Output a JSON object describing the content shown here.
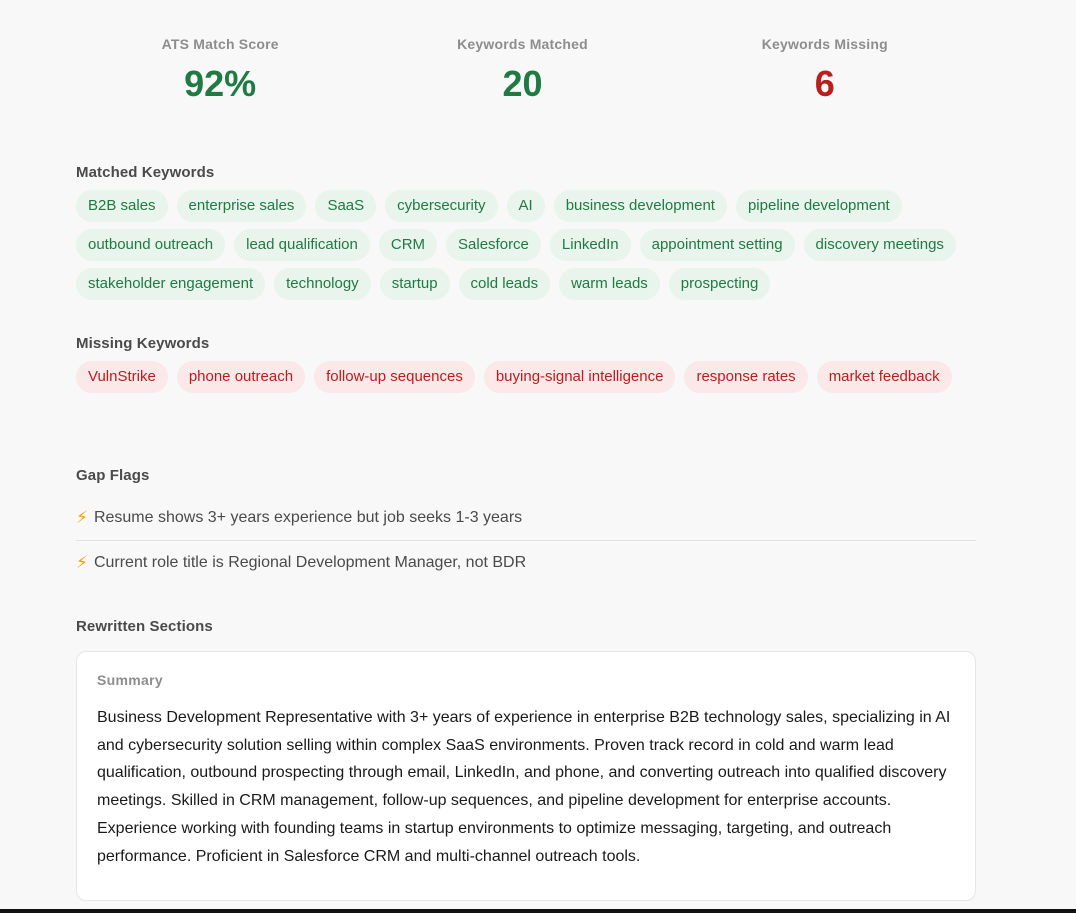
{
  "stats": [
    {
      "label": "ATS Match Score",
      "value": "92%",
      "tone": "green"
    },
    {
      "label": "Keywords Matched",
      "value": "20",
      "tone": "green"
    },
    {
      "label": "Keywords Missing",
      "value": "6",
      "tone": "red"
    }
  ],
  "matched": {
    "title": "Matched Keywords",
    "items": [
      "B2B sales",
      "enterprise sales",
      "SaaS",
      "cybersecurity",
      "AI",
      "business development",
      "pipeline development",
      "outbound outreach",
      "lead qualification",
      "CRM",
      "Salesforce",
      "LinkedIn",
      "appointment setting",
      "discovery meetings",
      "stakeholder engagement",
      "technology",
      "startup",
      "cold leads",
      "warm leads",
      "prospecting"
    ]
  },
  "missing": {
    "title": "Missing Keywords",
    "items": [
      "VulnStrike",
      "phone outreach",
      "follow-up sequences",
      "buying-signal intelligence",
      "response rates",
      "market feedback"
    ]
  },
  "gaps": {
    "title": "Gap Flags",
    "items": [
      "Resume shows 3+ years experience but job seeks 1-3 years",
      "Current role title is Regional Development Manager, not BDR"
    ]
  },
  "rewritten": {
    "title": "Rewritten Sections",
    "summary_label": "Summary",
    "summary_text": "Business Development Representative with 3+ years of experience in enterprise B2B technology sales, specializing in AI and cybersecurity solution selling within complex SaaS environments. Proven track record in cold and warm lead qualification, outbound prospecting through email, LinkedIn, and phone, and converting outreach into qualified discovery meetings. Skilled in CRM management, follow-up sequences, and pipeline development for enterprise accounts. Experience working with founding teams in startup environments to optimize messaging, targeting, and outreach performance. Proficient in Salesforce CRM and multi-channel outreach tools."
  },
  "icons": {
    "gap_flag": "lightning-bolt-icon"
  },
  "colors": {
    "green": "#1f7a44",
    "red": "#b81e1e",
    "green_bg": "#e8f4ec",
    "red_bg": "#fbe8e8"
  }
}
